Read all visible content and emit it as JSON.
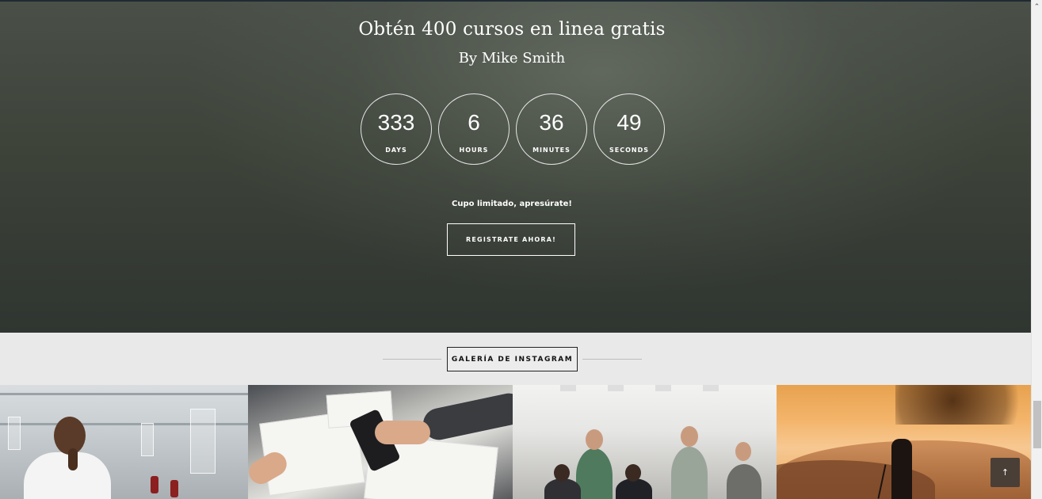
{
  "hero": {
    "title": "Obtén 400 cursos en linea gratis",
    "author": "By Mike Smith",
    "countdown": [
      {
        "value": "333",
        "label": "DAYS"
      },
      {
        "value": "6",
        "label": "HOURS"
      },
      {
        "value": "36",
        "label": "MINUTES"
      },
      {
        "value": "49",
        "label": "SECONDS"
      }
    ],
    "note": "Cupo limitado, apresúrate!",
    "cta_label": "REGISTRATE AHORA!"
  },
  "instagram": {
    "section_label": "GALERÍA DE INSTAGRAM",
    "photos": [
      {
        "icon": "lab-photo"
      },
      {
        "icon": "design-table-photo"
      },
      {
        "icon": "team-meeting-photo"
      },
      {
        "icon": "sunset-photographer-photo"
      }
    ]
  },
  "back_to_top": {
    "icon": "arrow-up-icon",
    "glyph": "↑"
  },
  "scrollbar": {
    "arrow_glyph": "⌃"
  }
}
